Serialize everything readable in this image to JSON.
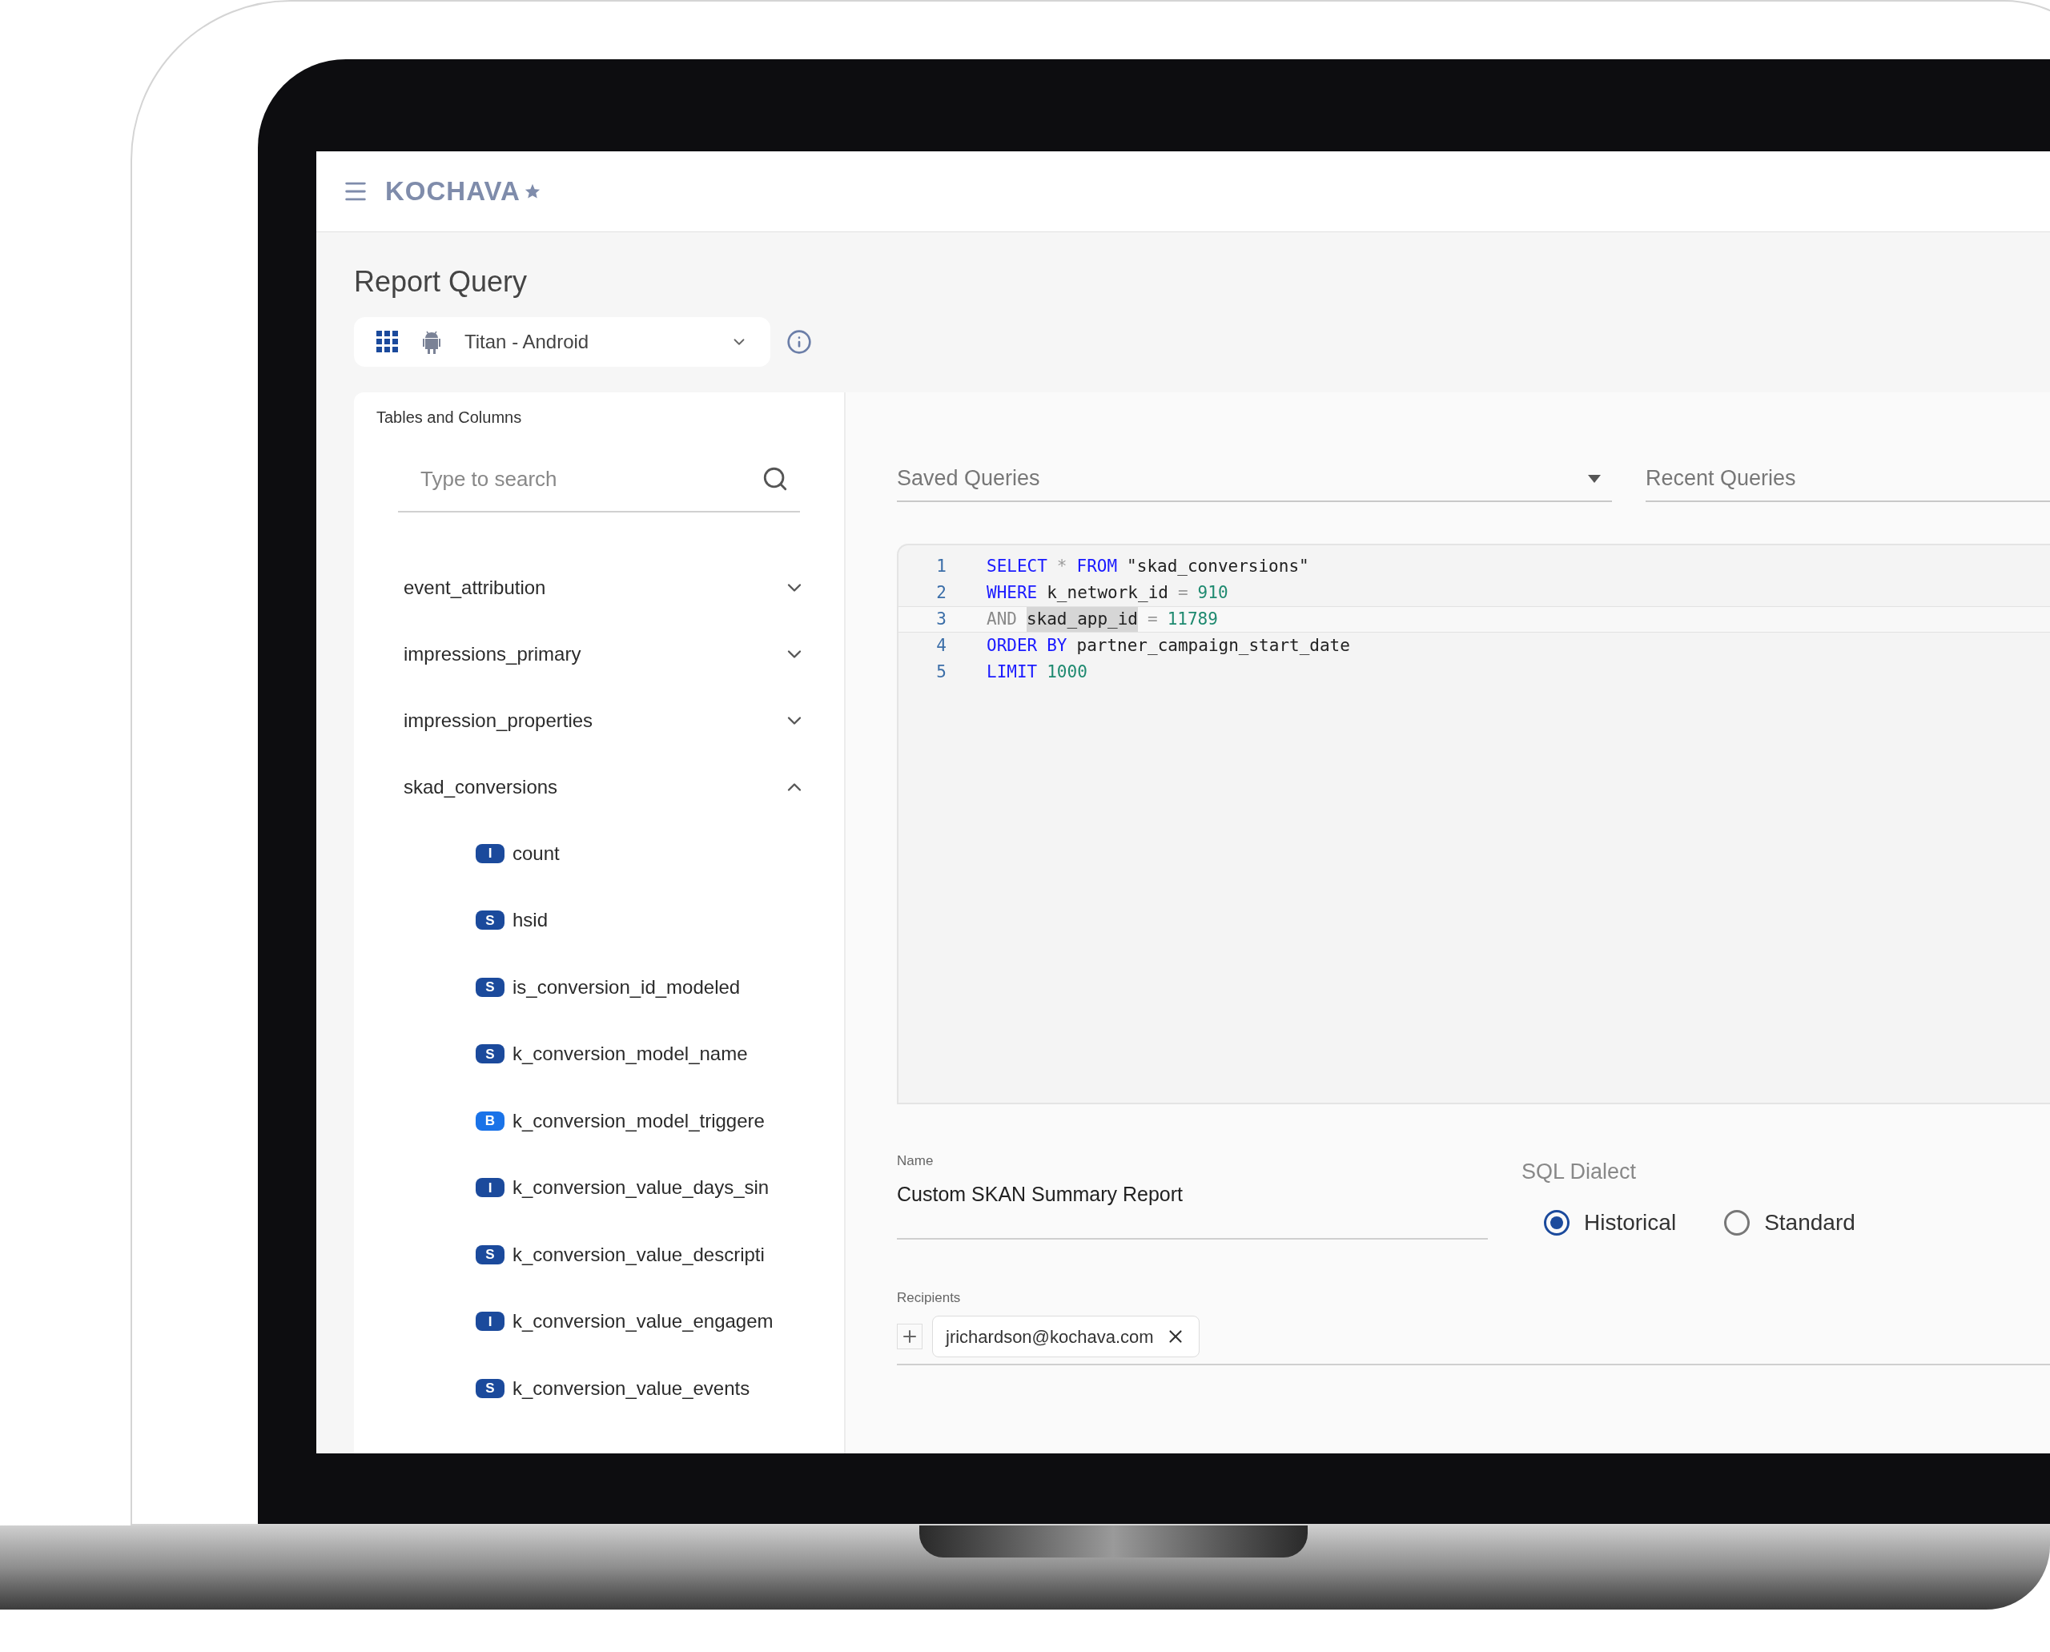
{
  "header": {
    "brand": "KOCHAVA"
  },
  "page_title": "Report Query",
  "app_selector": {
    "value": "Titan - Android"
  },
  "tables_panel": {
    "title": "Tables and Columns",
    "search": {
      "placeholder": "Type to search"
    },
    "tables": [
      {
        "name": "event_attribution",
        "expanded": false
      },
      {
        "name": "impressions_primary",
        "expanded": false
      },
      {
        "name": "impression_properties",
        "expanded": false
      },
      {
        "name": "skad_conversions",
        "expanded": true,
        "children": [
          {
            "badge": "I",
            "color": "#1b4a9c",
            "name": "count"
          },
          {
            "badge": "S",
            "color": "#1b4a9c",
            "name": "hsid"
          },
          {
            "badge": "S",
            "color": "#1b4a9c",
            "name": "is_conversion_id_modeled"
          },
          {
            "badge": "S",
            "color": "#1b4a9c",
            "name": "k_conversion_model_name"
          },
          {
            "badge": "B",
            "color": "#1a73e8",
            "name": "k_conversion_model_triggere"
          },
          {
            "badge": "I",
            "color": "#1b4a9c",
            "name": "k_conversion_value_days_sin"
          },
          {
            "badge": "S",
            "color": "#1b4a9c",
            "name": "k_conversion_value_descripti"
          },
          {
            "badge": "I",
            "color": "#1b4a9c",
            "name": "k_conversion_value_engagem"
          },
          {
            "badge": "S",
            "color": "#1b4a9c",
            "name": "k_conversion_value_events"
          }
        ]
      }
    ]
  },
  "queries": {
    "saved": {
      "placeholder": "Saved Queries"
    },
    "recent": {
      "placeholder": "Recent Queries"
    }
  },
  "editor": {
    "lines": [
      {
        "number": "1",
        "active": false,
        "tokens": [
          {
            "kind": "keyword",
            "text": "SELECT"
          },
          {
            "kind": "operator",
            "text": "*"
          },
          {
            "kind": "keyword",
            "text": "FROM"
          },
          {
            "kind": "plain",
            "text": "\"skad_conversions\""
          }
        ]
      },
      {
        "number": "2",
        "active": false,
        "tokens": [
          {
            "kind": "keyword",
            "text": "WHERE"
          },
          {
            "kind": "plain",
            "text": "k_network_id"
          },
          {
            "kind": "operator",
            "text": "="
          },
          {
            "kind": "number",
            "text": "910"
          }
        ]
      },
      {
        "number": "3",
        "active": true,
        "tokens": [
          {
            "kind": "muted",
            "text": "AND"
          },
          {
            "kind": "selected",
            "text": "skad_app_id"
          },
          {
            "kind": "operator",
            "text": "="
          },
          {
            "kind": "number",
            "text": "11789"
          }
        ]
      },
      {
        "number": "4",
        "active": false,
        "tokens": [
          {
            "kind": "keyword",
            "text": "ORDER"
          },
          {
            "kind": "keyword",
            "text": "BY"
          },
          {
            "kind": "plain",
            "text": "partner_campaign_start_date"
          }
        ]
      },
      {
        "number": "5",
        "active": false,
        "tokens": [
          {
            "kind": "keyword",
            "text": "LIMIT"
          },
          {
            "kind": "number",
            "text": "1000"
          }
        ]
      }
    ]
  },
  "form": {
    "name": {
      "label": "Name",
      "value": "Custom SKAN Summary Report"
    },
    "dialect": {
      "label": "SQL Dialect",
      "options": [
        {
          "label": "Historical",
          "selected": true
        },
        {
          "label": "Standard",
          "selected": false
        }
      ]
    },
    "recipients": {
      "label": "Recipients",
      "chips": [
        "jrichardson@kochava.com"
      ]
    }
  }
}
